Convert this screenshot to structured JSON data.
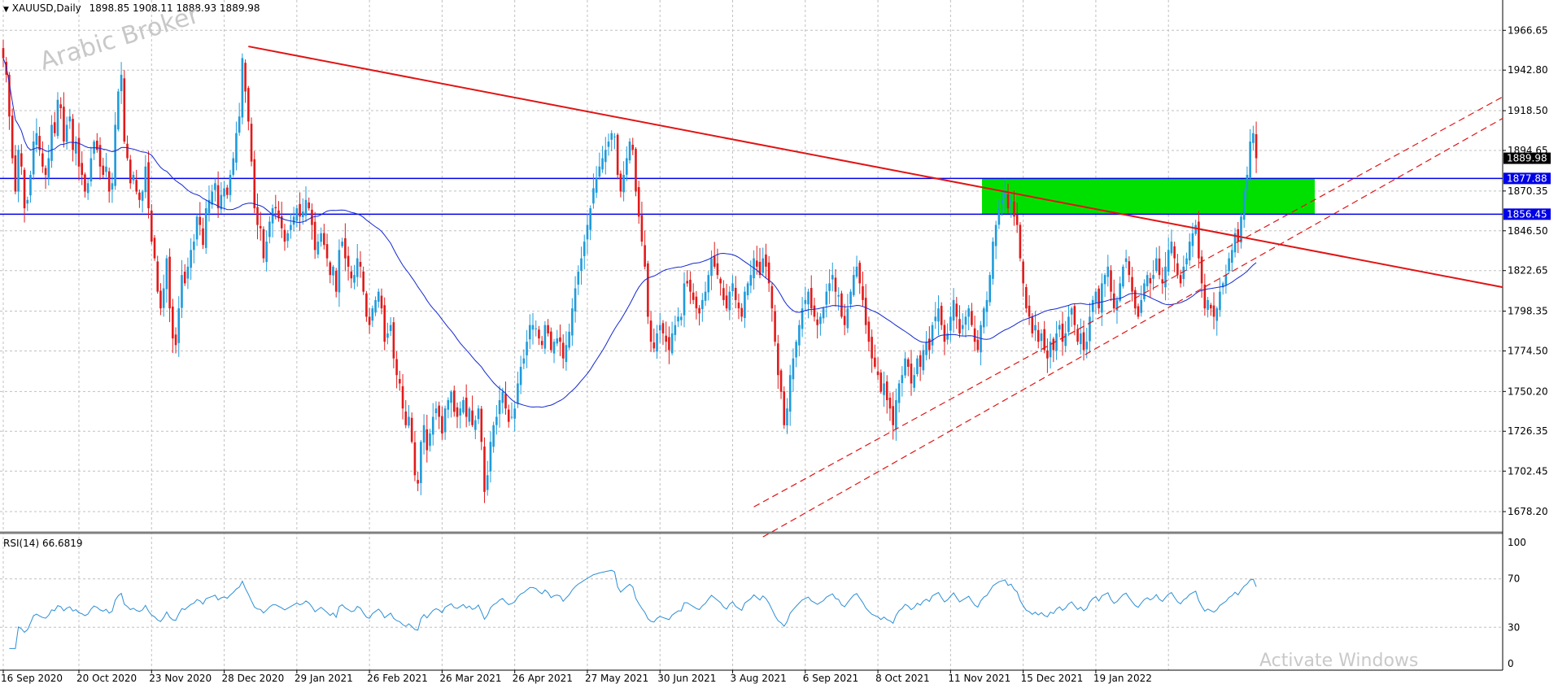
{
  "header": {
    "symbol": "XAUUSD,Daily",
    "ohlc": "1898.85 1908.11 1888.93 1889.98",
    "menu_arrow": "triangle-down-icon"
  },
  "rsi_header": "RSI(14) 66.6819",
  "watermark": "Arabic Broker",
  "activate": "Activate Windows",
  "colors": {
    "bull": "#1e9bdc",
    "bear": "#e21a1a",
    "ma": "#1428d2",
    "trend": "#e11414",
    "hline": "#0000e6",
    "zone": "#00e000",
    "rsi": "#2b8fd6"
  },
  "chart_data": [
    {
      "type": "candlestick",
      "title": "XAUUSD,Daily",
      "y_ticks": [
        "1966.65",
        "1942.80",
        "1918.50",
        "1894.65",
        "1870.35",
        "1846.50",
        "1822.65",
        "1798.35",
        "1774.50",
        "1750.20",
        "1726.35",
        "1702.45",
        "1678.20"
      ],
      "x_ticks": [
        "16 Sep 2020",
        "20 Oct 2020",
        "23 Nov 2020",
        "28 Dec 2020",
        "29 Jan 2021",
        "26 Feb 2021",
        "26 Mar 2021",
        "26 Apr 2021",
        "27 May 2021",
        "30 Jun 2021",
        "3 Aug 2021",
        "6 Sep 2021",
        "8 Oct 2021",
        "11 Nov 2021",
        "15 Dec 2021",
        "19 Jan 2022"
      ],
      "ylim": [
        1667,
        1978
      ],
      "last_price": "1889.98",
      "closes": [
        1950,
        1940,
        1915,
        1890,
        1870,
        1895,
        1885,
        1860,
        1865,
        1880,
        1900,
        1905,
        1895,
        1885,
        1880,
        1890,
        1910,
        1905,
        1925,
        1920,
        1900,
        1910,
        1915,
        1895,
        1900,
        1885,
        1880,
        1870,
        1875,
        1890,
        1900,
        1895,
        1885,
        1880,
        1885,
        1870,
        1875,
        1910,
        1930,
        1940,
        1900,
        1890,
        1875,
        1880,
        1870,
        1865,
        1870,
        1885,
        1860,
        1840,
        1830,
        1810,
        1800,
        1812,
        1830,
        1800,
        1782,
        1778,
        1800,
        1820,
        1815,
        1825,
        1835,
        1840,
        1855,
        1850,
        1838,
        1860,
        1865,
        1870,
        1875,
        1860,
        1868,
        1872,
        1868,
        1880,
        1890,
        1905,
        1915,
        1950,
        1930,
        1912,
        1888,
        1860,
        1850,
        1848,
        1830,
        1840,
        1852,
        1860,
        1860,
        1854,
        1848,
        1840,
        1845,
        1850,
        1855,
        1860,
        1855,
        1858,
        1865,
        1860,
        1850,
        1835,
        1840,
        1845,
        1838,
        1830,
        1820,
        1825,
        1810,
        1835,
        1840,
        1830,
        1825,
        1818,
        1820,
        1830,
        1825,
        1810,
        1795,
        1790,
        1800,
        1805,
        1810,
        1800,
        1780,
        1785,
        1790,
        1770,
        1760,
        1755,
        1740,
        1730,
        1735,
        1720,
        1700,
        1695,
        1720,
        1730,
        1715,
        1725,
        1735,
        1740,
        1735,
        1725,
        1740,
        1745,
        1750,
        1738,
        1735,
        1740,
        1745,
        1735,
        1740,
        1730,
        1733,
        1740,
        1720,
        1690,
        1700,
        1720,
        1730,
        1735,
        1745,
        1750,
        1740,
        1732,
        1735,
        1740,
        1755,
        1765,
        1770,
        1780,
        1790,
        1790,
        1788,
        1782,
        1778,
        1790,
        1785,
        1775,
        1780,
        1782,
        1780,
        1770,
        1778,
        1786,
        1800,
        1812,
        1822,
        1830,
        1840,
        1850,
        1860,
        1872,
        1878,
        1885,
        1890,
        1895,
        1900,
        1905,
        1903,
        1880,
        1870,
        1880,
        1890,
        1900,
        1895,
        1870,
        1855,
        1840,
        1825,
        1795,
        1780,
        1776,
        1785,
        1790,
        1785,
        1780,
        1775,
        1785,
        1790,
        1795,
        1795,
        1815,
        1815,
        1810,
        1805,
        1800,
        1797,
        1805,
        1810,
        1820,
        1830,
        1825,
        1820,
        1815,
        1805,
        1800,
        1810,
        1815,
        1805,
        1800,
        1795,
        1810,
        1815,
        1820,
        1830,
        1825,
        1820,
        1830,
        1825,
        1815,
        1800,
        1780,
        1760,
        1750,
        1730,
        1740,
        1760,
        1770,
        1780,
        1790,
        1800,
        1805,
        1810,
        1800,
        1795,
        1790,
        1795,
        1800,
        1810,
        1815,
        1820,
        1810,
        1808,
        1795,
        1790,
        1800,
        1810,
        1820,
        1825,
        1815,
        1805,
        1790,
        1780,
        1770,
        1765,
        1760,
        1750,
        1755,
        1745,
        1740,
        1730,
        1745,
        1755,
        1760,
        1770,
        1765,
        1755,
        1760,
        1770,
        1765,
        1775,
        1780,
        1775,
        1790,
        1795,
        1800,
        1790,
        1780,
        1785,
        1795,
        1805,
        1795,
        1785,
        1790,
        1795,
        1800,
        1790,
        1780,
        1775,
        1790,
        1800,
        1805,
        1820,
        1840,
        1850,
        1860,
        1865,
        1870,
        1860,
        1865,
        1855,
        1850,
        1830,
        1815,
        1800,
        1795,
        1785,
        1790,
        1780,
        1785,
        1775,
        1770,
        1780,
        1775,
        1785,
        1790,
        1780,
        1785,
        1795,
        1800,
        1790,
        1780,
        1785,
        1775,
        1780,
        1795,
        1805,
        1810,
        1800,
        1815,
        1820,
        1825,
        1810,
        1800,
        1805,
        1815,
        1825,
        1830,
        1820,
        1810,
        1800,
        1795,
        1805,
        1815,
        1820,
        1815,
        1820,
        1830,
        1820,
        1815,
        1825,
        1835,
        1840,
        1830,
        1820,
        1815,
        1825,
        1830,
        1840,
        1845,
        1850,
        1830,
        1815,
        1800,
        1805,
        1800,
        1795,
        1800,
        1810,
        1815,
        1820,
        1830,
        1835,
        1845,
        1840,
        1855,
        1870,
        1880,
        1900,
        1905,
        1890
      ]
    },
    {
      "type": "line",
      "title": "RSI(14) 66.6819",
      "y_ticks": [
        "100",
        "70",
        "30",
        "0"
      ],
      "ylim": [
        0,
        100
      ]
    }
  ],
  "levels": [
    {
      "label": "1877.88",
      "value": 1877.88
    },
    {
      "label": "1856.45",
      "value": 1856.45
    }
  ],
  "zone": {
    "from_date": "Oct 2021",
    "to_date": "Feb 2022",
    "low": 1856.45,
    "high": 1877.88
  },
  "trendline": {
    "p1": {
      "index": 81,
      "price": 1957
    },
    "p2": {
      "index": 394,
      "price": 1848
    }
  },
  "channel": [
    {
      "p1": {
        "index": 248,
        "price": 1681
      },
      "p2": {
        "index": 398,
        "price": 1830
      }
    },
    {
      "p1": {
        "index": 251,
        "price": 1663
      },
      "p2": {
        "index": 402,
        "price": 1818
      }
    }
  ]
}
